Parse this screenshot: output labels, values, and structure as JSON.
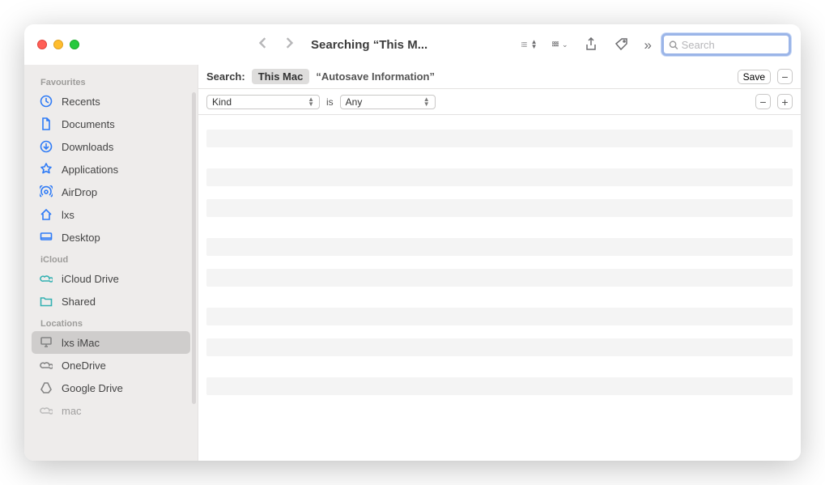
{
  "window": {
    "title": "Searching “This M..."
  },
  "search": {
    "placeholder": "Search",
    "value": ""
  },
  "sidebar": {
    "sections": [
      {
        "label": "Favourites",
        "items": [
          {
            "icon": "clock",
            "label": "Recents"
          },
          {
            "icon": "doc",
            "label": "Documents"
          },
          {
            "icon": "download",
            "label": "Downloads"
          },
          {
            "icon": "apps",
            "label": "Applications"
          },
          {
            "icon": "airdrop",
            "label": "AirDrop"
          },
          {
            "icon": "home",
            "label": "lxs"
          },
          {
            "icon": "desktop",
            "label": "Desktop"
          }
        ]
      },
      {
        "label": "iCloud",
        "items": [
          {
            "icon": "cloud",
            "label": "iCloud Drive",
            "tint": "teal"
          },
          {
            "icon": "folder",
            "label": "Shared",
            "tint": "teal"
          }
        ]
      },
      {
        "label": "Locations",
        "items": [
          {
            "icon": "imac",
            "label": "lxs iMac",
            "tint": "grey",
            "selected": true
          },
          {
            "icon": "cloud",
            "label": "OneDrive",
            "tint": "grey"
          },
          {
            "icon": "gdrive",
            "label": "Google Drive",
            "tint": "grey"
          },
          {
            "icon": "cloud",
            "label": "mac",
            "tint": "grey"
          }
        ]
      }
    ]
  },
  "scope": {
    "label": "Search:",
    "active": "This Mac",
    "other": "“Autosave Information”",
    "save": "Save"
  },
  "criteria": {
    "attr": "Kind",
    "is": "is",
    "value": "Any"
  }
}
